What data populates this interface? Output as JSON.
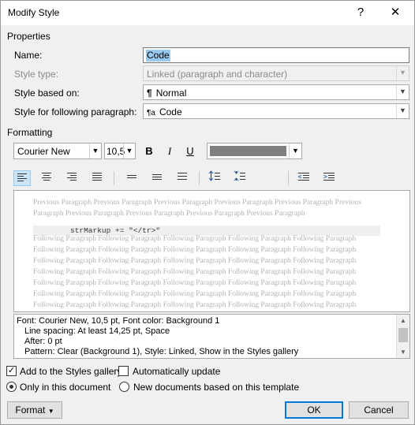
{
  "window": {
    "title": "Modify Style",
    "help_icon": "?",
    "close_icon": "✕"
  },
  "properties": {
    "heading": "Properties",
    "name_label": "Name:",
    "name_value": "Code",
    "style_type_label": "Style type:",
    "style_type_value": "Linked (paragraph and character)",
    "based_on_label": "Style based on:",
    "based_on_value": "Normal",
    "based_on_icon": "¶",
    "following_label": "Style for following paragraph:",
    "following_value": "Code",
    "following_icon": "¶a"
  },
  "formatting": {
    "heading": "Formatting",
    "font_name": "Courier New",
    "font_size": "10,5",
    "bold": "B",
    "italic": "I",
    "underline": "U",
    "font_color": "#7f7f7f"
  },
  "preview": {
    "previous_lines": [
      "Previous Paragraph Previous Paragraph Previous Paragraph Previous Paragraph Previous Paragraph Previous",
      "Paragraph Previous Paragraph Previous Paragraph Previous Paragraph Previous Paragraph"
    ],
    "code_line": "strMarkup += \"</tr>\"",
    "following_lines": [
      "Following Paragraph Following Paragraph Following Paragraph Following Paragraph Following Paragraph",
      "Following Paragraph Following Paragraph Following Paragraph Following Paragraph Following Paragraph",
      "Following Paragraph Following Paragraph Following Paragraph Following Paragraph Following Paragraph",
      "Following Paragraph Following Paragraph Following Paragraph Following Paragraph Following Paragraph",
      "Following Paragraph Following Paragraph Following Paragraph Following Paragraph Following Paragraph",
      "Following Paragraph Following Paragraph Following Paragraph Following Paragraph Following Paragraph",
      "Following Paragraph Following Paragraph Following Paragraph Following Paragraph Following Paragraph"
    ]
  },
  "description": {
    "lines": [
      "Font: Courier New, 10,5 pt, Font color: Background 1",
      "Line spacing:  At least 14,25 pt, Space",
      "After:  0 pt",
      "Pattern: Clear (Background 1), Style: Linked, Show in the Styles gallery"
    ]
  },
  "options": {
    "add_to_gallery": "Add to the Styles gallery",
    "auto_update": "Automatically update",
    "only_this_doc": "Only in this document",
    "new_docs": "New documents based on this template"
  },
  "buttons": {
    "format": "Format",
    "ok": "OK",
    "cancel": "Cancel"
  }
}
